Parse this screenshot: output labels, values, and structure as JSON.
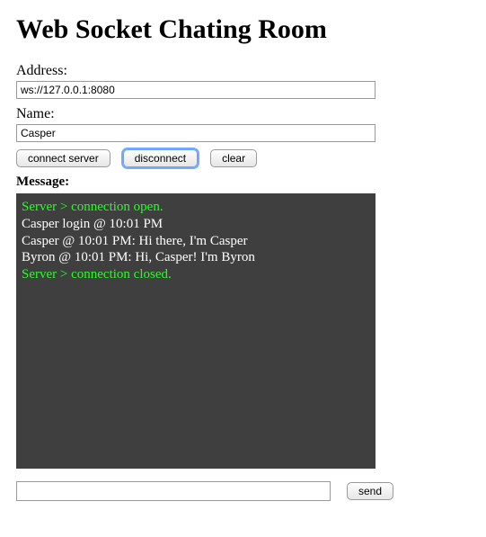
{
  "title": "Web Socket Chating Room",
  "address": {
    "label": "Address:",
    "value": "ws://127.0.0.1:8080"
  },
  "name": {
    "label": "Name:",
    "value": "Casper"
  },
  "buttons": {
    "connect": "connect server",
    "disconnect": "disconnect",
    "clear": "clear"
  },
  "message_label": "Message:",
  "messages": [
    {
      "kind": "server",
      "text": "Server > connection open."
    },
    {
      "kind": "user",
      "text": "Casper login @ 10:01 PM"
    },
    {
      "kind": "user",
      "text": "Casper @ 10:01 PM: Hi there, I'm Casper"
    },
    {
      "kind": "user",
      "text": "Byron @ 10:01 PM: Hi, Casper! I'm Byron"
    },
    {
      "kind": "server",
      "text": "Server > connection closed."
    }
  ],
  "send": {
    "value": "",
    "placeholder": "",
    "button": "send"
  }
}
